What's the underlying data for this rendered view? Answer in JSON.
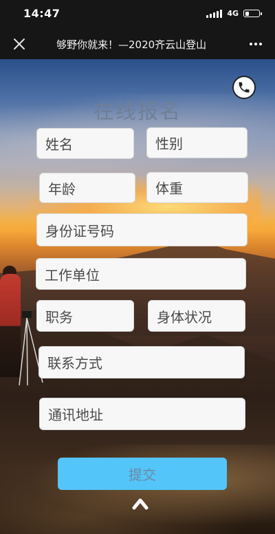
{
  "status_bar": {
    "time": "14:47",
    "network": "4G",
    "battery_level": 0.25
  },
  "nav": {
    "close_icon": "close-icon",
    "title": "够野你就来！—2020齐云山登山",
    "more_icon": "more-icon"
  },
  "form": {
    "title": "在线报名",
    "fields": {
      "name": "姓名",
      "gender": "性别",
      "age": "年龄",
      "weight": "体重",
      "id_number": "身份证号码",
      "employer": "工作单位",
      "position": "职务",
      "health": "身体状况",
      "contact": "联系方式",
      "address": "通讯地址"
    },
    "submit_label": "提交"
  },
  "colors": {
    "submit_button": "#54c5f8",
    "title_text": "#6f7f97"
  }
}
